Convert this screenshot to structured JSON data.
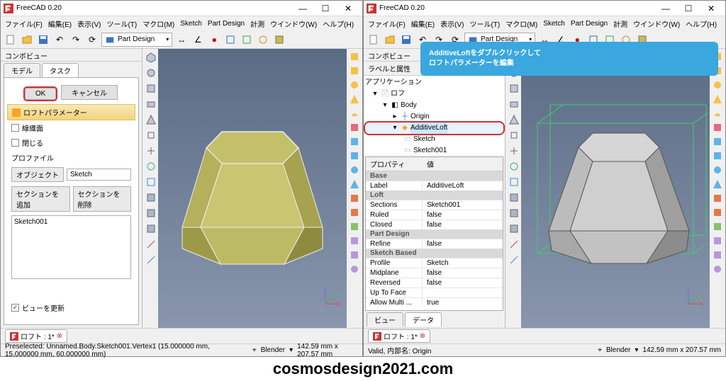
{
  "app_title": "FreeCAD 0.20",
  "wincontrols": {
    "min": "—",
    "max": "☐",
    "close": "✕"
  },
  "menus": [
    "ファイル(F)",
    "編集(E)",
    "表示(V)",
    "ツール(T)",
    "マクロ(M)",
    "Sketch",
    "Part Design",
    "計測",
    "ウインドウ(W)",
    "ヘルプ(H)"
  ],
  "workbench": "Part Design",
  "combo_title": "コンボビュー",
  "tabs_left_win1": {
    "model": "モデル",
    "task": "タスク"
  },
  "dialog": {
    "ok": "OK",
    "cancel": "キャンセル",
    "group_title": "ロフトパラメーター",
    "chk_ruled": "線織面",
    "chk_closed": "閉じる",
    "profile_label": "プロファイル",
    "object_label": "オブジェクト",
    "object_value": "Sketch",
    "btn_add": "セクションを追加",
    "btn_remove": "セクションを削除",
    "section_item": "Sketch001",
    "update_view": "ビューを更新"
  },
  "doc_tab": "ロフト : 1*",
  "status_left_1": "Preselected: Unnamed.Body.Sketch001.Vertex1 (15.000000 mm, 15.000000 mm, 60.000000 mm)",
  "status_left_2": "Valid, 内部名: Origin",
  "nav_style": "Blender",
  "dims": "142.59 mm x 207.57 mm",
  "tree": {
    "labels_head": "ラベルと属性",
    "app": "アプリケーション",
    "doc": "ロフ",
    "body": "Body",
    "origin": "Origin",
    "loft": "AdditiveLoft",
    "sketch": "Sketch",
    "sketch001": "Sketch001"
  },
  "props": {
    "head_name": "プロパティ",
    "head_val": "値",
    "g_base": "Base",
    "label_n": "Label",
    "label_v": "AdditiveLoft",
    "g_loft": "Loft",
    "sections_n": "Sections",
    "sections_v": "Sketch001",
    "ruled_n": "Ruled",
    "ruled_v": "false",
    "closed_n": "Closed",
    "closed_v": "false",
    "g_pd": "Part Design",
    "refine_n": "Refine",
    "refine_v": "false",
    "g_sb": "Sketch Based",
    "profile_n": "Profile",
    "profile_v": "Sketch",
    "midplane_n": "Midplane",
    "midplane_v": "false",
    "reversed_n": "Reversed",
    "reversed_v": "false",
    "uptoface_n": "Up To Face",
    "uptoface_v": "",
    "allowmulti_n": "Allow Multi ...",
    "allowmulti_v": "true"
  },
  "bottom_tabs": {
    "view": "ビュー",
    "data": "データ"
  },
  "callout_l1": "AdditiveLoftをダブルクリックして",
  "callout_l2": "ロフトパラメーターを編集",
  "footer": "cosmosdesign2021.com"
}
